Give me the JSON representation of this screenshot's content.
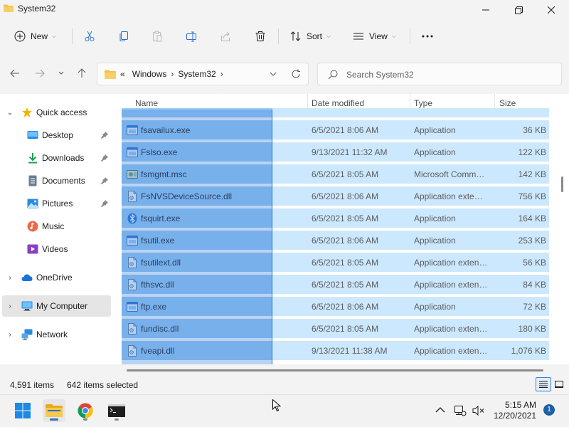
{
  "window": {
    "title": "System32"
  },
  "commandbar": {
    "new_label": "New",
    "sort_label": "Sort",
    "view_label": "View"
  },
  "address": {
    "overflow": "«",
    "crumbs": [
      "Windows",
      "System32"
    ]
  },
  "search": {
    "placeholder": "Search System32"
  },
  "sidebar": {
    "quick_access": "Quick access",
    "items": [
      {
        "label": "Desktop",
        "icon": "desktop-icon"
      },
      {
        "label": "Downloads",
        "icon": "download-icon"
      },
      {
        "label": "Documents",
        "icon": "documents-icon"
      },
      {
        "label": "Pictures",
        "icon": "pictures-icon"
      },
      {
        "label": "Music",
        "icon": "music-icon"
      },
      {
        "label": "Videos",
        "icon": "videos-icon"
      }
    ],
    "onedrive": "OneDrive",
    "my_computer": "My Computer",
    "network": "Network"
  },
  "columns": {
    "name": "Name",
    "date": "Date modified",
    "type": "Type",
    "size": "Size"
  },
  "files": [
    {
      "name": "fsavailux.exe",
      "date": "6/5/2021 8:06 AM",
      "type": "Application",
      "size": "36 KB",
      "icon": "exe-icon"
    },
    {
      "name": "Fslso.exe",
      "date": "9/13/2021 11:32 AM",
      "type": "Application",
      "size": "122 KB",
      "icon": "exe-icon"
    },
    {
      "name": "fsmgmt.msc",
      "date": "6/5/2021 8:05 AM",
      "type": "Microsoft Comm…",
      "size": "142 KB",
      "icon": "msc-icon"
    },
    {
      "name": "FsNVSDeviceSource.dll",
      "date": "6/5/2021 8:06 AM",
      "type": "Application exte…",
      "size": "756 KB",
      "icon": "dll-icon"
    },
    {
      "name": "fsquirt.exe",
      "date": "6/5/2021 8:05 AM",
      "type": "Application",
      "size": "164 KB",
      "icon": "bluetooth-icon"
    },
    {
      "name": "fsutil.exe",
      "date": "6/5/2021 8:06 AM",
      "type": "Application",
      "size": "253 KB",
      "icon": "exe-icon"
    },
    {
      "name": "fsutilext.dll",
      "date": "6/5/2021 8:05 AM",
      "type": "Application exten…",
      "size": "56 KB",
      "icon": "dll-icon"
    },
    {
      "name": "fthsvc.dll",
      "date": "6/5/2021 8:05 AM",
      "type": "Application exten…",
      "size": "84 KB",
      "icon": "dll-icon"
    },
    {
      "name": "ftp.exe",
      "date": "6/5/2021 8:06 AM",
      "type": "Application",
      "size": "72 KB",
      "icon": "exe-icon"
    },
    {
      "name": "fundisc.dll",
      "date": "6/5/2021 8:05 AM",
      "type": "Application exten…",
      "size": "180 KB",
      "icon": "dll-icon"
    },
    {
      "name": "fveapi.dll",
      "date": "9/13/2021 11:38 AM",
      "type": "Application exten…",
      "size": "1,076 KB",
      "icon": "dll-icon"
    }
  ],
  "status": {
    "items": "4,591 items",
    "selected": "642 items selected"
  },
  "taskbar": {
    "time": "5:15 AM",
    "date": "12/20/2021",
    "notifications": "1"
  },
  "colors": {
    "selection": "#cce8ff",
    "accent": "#2a6fd0",
    "folder": "#f4c04a"
  }
}
